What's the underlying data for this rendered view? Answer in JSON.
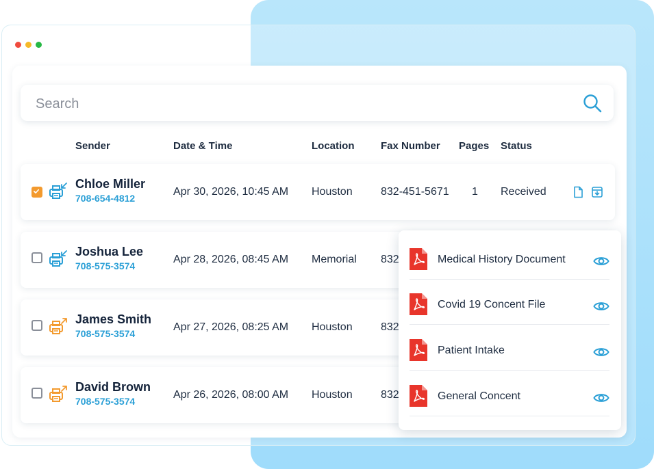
{
  "search": {
    "placeholder": "Search"
  },
  "columns": {
    "sender": "Sender",
    "datetime": "Date & Time",
    "location": "Location",
    "fax_number": "Fax Number",
    "pages": "Pages",
    "status": "Status"
  },
  "rows": [
    {
      "name": "Chloe Miller",
      "phone": "708-654-4812",
      "datetime": "Apr 30, 2026, 10:45 AM",
      "location": "Houston",
      "fax": "832-451-5671",
      "pages": "1",
      "status": "Received",
      "checked": true,
      "direction": "incoming"
    },
    {
      "name": "Joshua Lee",
      "phone": "708-575-3574",
      "datetime": "Apr 28, 2026, 08:45 AM",
      "location": "Memorial",
      "fax": "832",
      "checked": false,
      "direction": "incoming"
    },
    {
      "name": "James Smith",
      "phone": "708-575-3574",
      "datetime": "Apr 27, 2026, 08:25 AM",
      "location": "Houston",
      "fax": "832",
      "checked": false,
      "direction": "outgoing"
    },
    {
      "name": "David Brown",
      "phone": "708-575-3574",
      "datetime": "Apr 26, 2026, 08:00 AM",
      "location": "Houston",
      "fax": "832",
      "checked": false,
      "direction": "outgoing"
    }
  ],
  "documents": [
    {
      "label": "Medical History Document"
    },
    {
      "label": "Covid 19 Concent File"
    },
    {
      "label": "Patient Intake"
    },
    {
      "label": "General Concent"
    }
  ],
  "icons": {
    "search": "search-icon",
    "fax_incoming": "fax-incoming-icon",
    "fax_outgoing": "fax-outgoing-icon",
    "document": "document-icon",
    "download": "download-icon",
    "pdf": "pdf-file-icon",
    "view": "eye-icon"
  },
  "colors": {
    "accent_blue": "#2a9fd6",
    "accent_orange": "#f39a2e",
    "pdf_red": "#e8352b",
    "backdrop_blue": "#a8e0fb"
  }
}
